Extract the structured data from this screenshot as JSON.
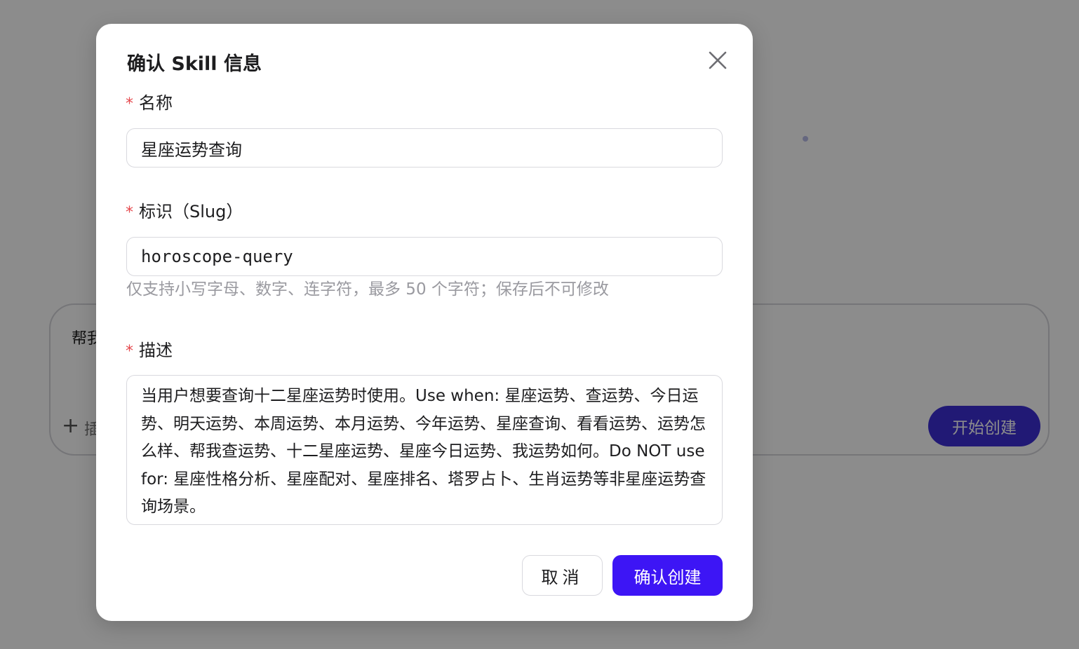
{
  "background": {
    "composer_text": "帮我",
    "attach_label": "插",
    "start_button_label": "开始创建"
  },
  "dialog": {
    "title": "确认 Skill 信息",
    "name_field": {
      "required_mark": "*",
      "label": "名称",
      "value": "星座运势查询"
    },
    "slug_field": {
      "required_mark": "*",
      "label": "标识（Slug）",
      "value": "horoscope-query",
      "hint": "仅支持小写字母、数字、连字符，最多 50 个字符；保存后不可修改"
    },
    "description_field": {
      "required_mark": "*",
      "label": "描述",
      "value": "当用户想要查询十二星座运势时使用。Use when: 星座运势、查运势、今日运势、明天运势、本周运势、本月运势、今年运势、星座查询、看看运势、运势怎么样、帮我查运势、十二星座运势、星座今日运势、我运势如何。Do NOT use for: 星座性格分析、星座配对、星座排名、塔罗占卜、生肖运势等非星座运势查询场景。"
    },
    "cancel_label": "取消",
    "confirm_label": "确认创建"
  },
  "colors": {
    "accent": "#3d15f5",
    "required": "#e5484d",
    "overlay": "rgba(0,0,0,0.45)"
  }
}
